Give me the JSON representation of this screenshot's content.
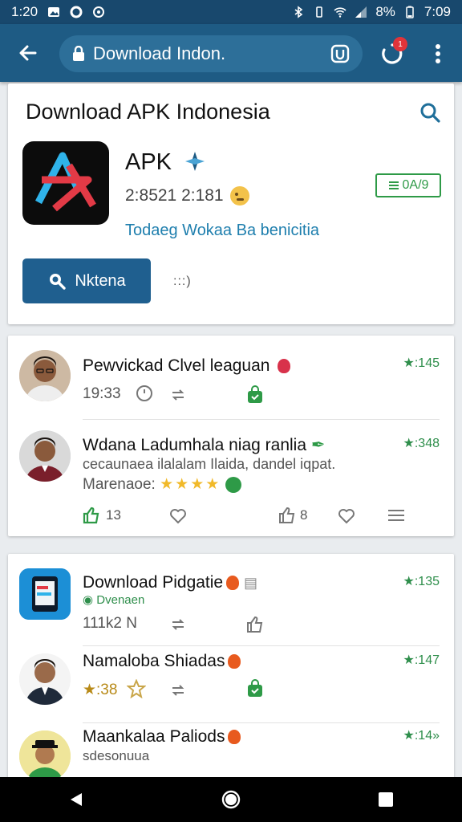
{
  "statusbar": {
    "time": "1:20",
    "battery": "8%",
    "clock": "7:09"
  },
  "browser": {
    "url": "Download Indon.",
    "tab_count": "1",
    "accent": "#1e5b84"
  },
  "header": {
    "title": "Download APK Indonesia"
  },
  "app": {
    "name": "APK",
    "meta": "2:8521 2:181",
    "rating_pill": "0А/9",
    "link": "Todaeg Wokaa Ba benicitia",
    "primary_button": "Nktena",
    "more": ":::)"
  },
  "reviews": [
    {
      "name": "Pewvickad Clvel leaguan",
      "score": "★:145",
      "time": "19:33"
    },
    {
      "name": "Wdana Ladumhala niag ranlia",
      "score": "★:348",
      "text": "cecaunaea ilalalam Ilaida, dandel iqpat.",
      "footer": "Marenaoe:",
      "stars": "★★★★"
    }
  ],
  "review_actions": {
    "like_count": "13",
    "thumbs_count": "8"
  },
  "downloads": [
    {
      "name": "Download Pidgatie",
      "score": "★:135",
      "sub": "Dvenaen",
      "meta": "111k2 N"
    },
    {
      "name": "Namaloba Shiadas",
      "score": "★:147",
      "meta": "★:38"
    },
    {
      "name": "Maankalaa Paliods",
      "score": "★:14»",
      "sub": "sdesonuua"
    }
  ],
  "colors": {
    "green": "#2e9a47",
    "link": "#1f7fae",
    "button": "#1f5f8f"
  }
}
